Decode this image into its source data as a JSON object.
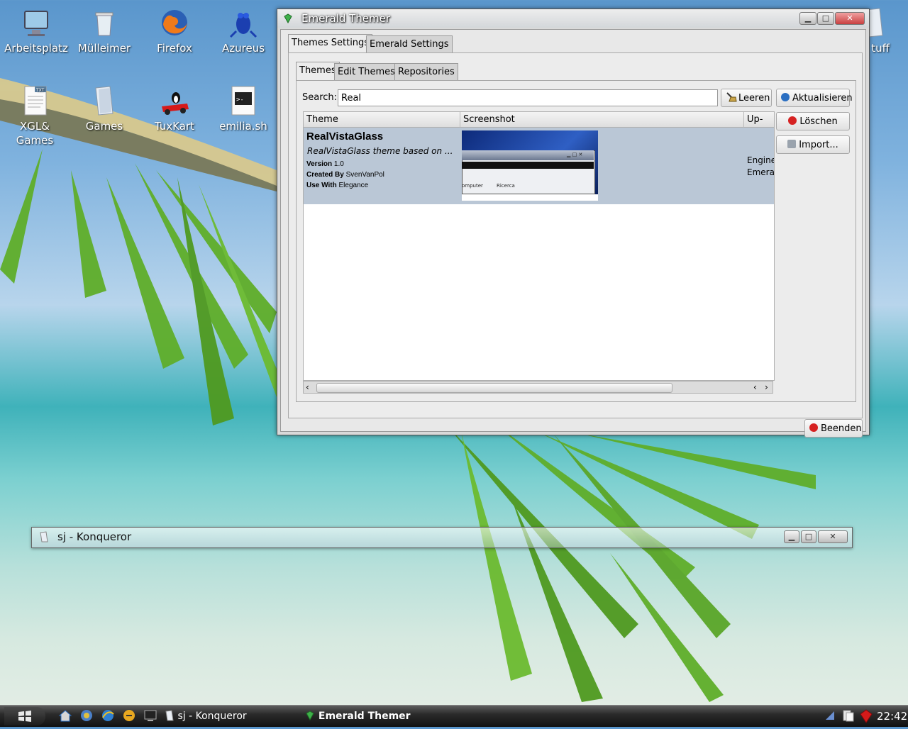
{
  "desktop": {
    "icons": [
      {
        "label": "Arbeitsplatz",
        "icon": "computer-icon"
      },
      {
        "label": "Mülleimer",
        "icon": "trash-icon"
      },
      {
        "label": "Firefox",
        "icon": "firefox-icon"
      },
      {
        "label": "Azureus",
        "icon": "azureus-frog-icon"
      },
      {
        "label": "XGL&\nGames",
        "icon": "text-file-icon"
      },
      {
        "label": "Games",
        "icon": "folder-icon"
      },
      {
        "label": "TuxKart",
        "icon": "tuxkart-icon"
      },
      {
        "label": "emilia.sh",
        "icon": "terminal-script-icon"
      },
      {
        "label": "tuff",
        "icon": "folder-icon"
      }
    ]
  },
  "emerald": {
    "title": "Emerald Themer",
    "top_tabs": [
      "Themes Settings",
      "Emerald Settings"
    ],
    "sub_tabs": [
      "Themes",
      "Edit Themes",
      "Repositories"
    ],
    "search": {
      "label": "Search:",
      "value": "Real",
      "clear_label": "Leeren"
    },
    "columns": [
      "Theme",
      "Screenshot",
      "Up-to-"
    ],
    "theme": {
      "name": "RealVistaGlass",
      "description": "RealVistaGlass theme based on ...",
      "version_key": "Version",
      "version": "1.0",
      "created_key": "Created By",
      "created": "SvenVanPol",
      "use_key": "Use With",
      "use": "Elegance",
      "uptodate_line1": "Engine",
      "uptodate_line2": "Emera",
      "preview_labels": [
        "omputer",
        "Ricerca"
      ]
    },
    "side_buttons": [
      "Aktualisieren",
      "Löschen",
      "Import..."
    ],
    "quit_label": "Beenden"
  },
  "konqueror": {
    "title": "sj - Konqueror"
  },
  "taskbar": {
    "tasks": [
      "sj - Konqueror",
      "Emerald Themer"
    ],
    "clock": "22:42"
  },
  "colors": {
    "selection": "#bac7d6",
    "accent": "#2b6fc2",
    "emerald": "#3fb04a"
  }
}
